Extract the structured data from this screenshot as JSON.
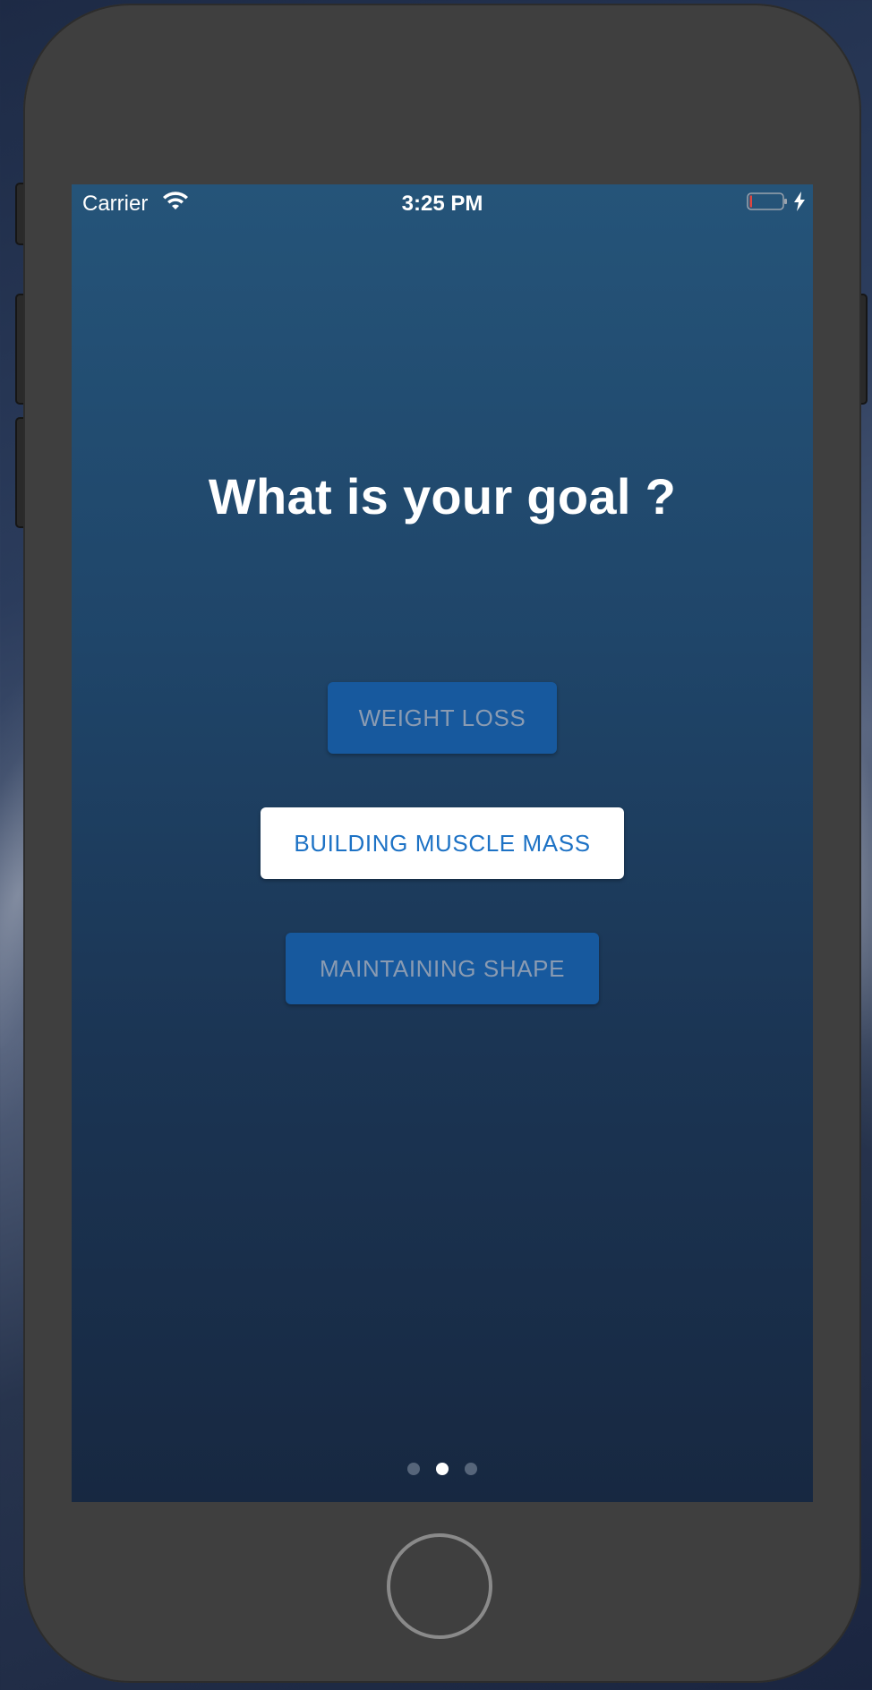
{
  "status_bar": {
    "carrier": "Carrier",
    "time": "3:25 PM",
    "wifi_icon": "wifi-icon",
    "battery_icon": "battery-low-icon",
    "charging_icon": "charging-bolt-icon"
  },
  "screen": {
    "title": "What is your goal ?",
    "options": [
      {
        "label": "WEIGHT LOSS",
        "selected": false
      },
      {
        "label": "BUILDING MUSCLE MASS",
        "selected": true
      },
      {
        "label": "MAINTAINING SHAPE",
        "selected": false
      }
    ],
    "pager": {
      "total": 3,
      "current": 2
    }
  },
  "colors": {
    "screen_top": "#255479",
    "screen_bottom": "#172841",
    "button_inactive_bg": "#17599e",
    "button_inactive_text": "#8a9bb2",
    "button_active_bg": "#ffffff",
    "button_active_text": "#1d72c5",
    "device_body": "#3f3f3f"
  }
}
